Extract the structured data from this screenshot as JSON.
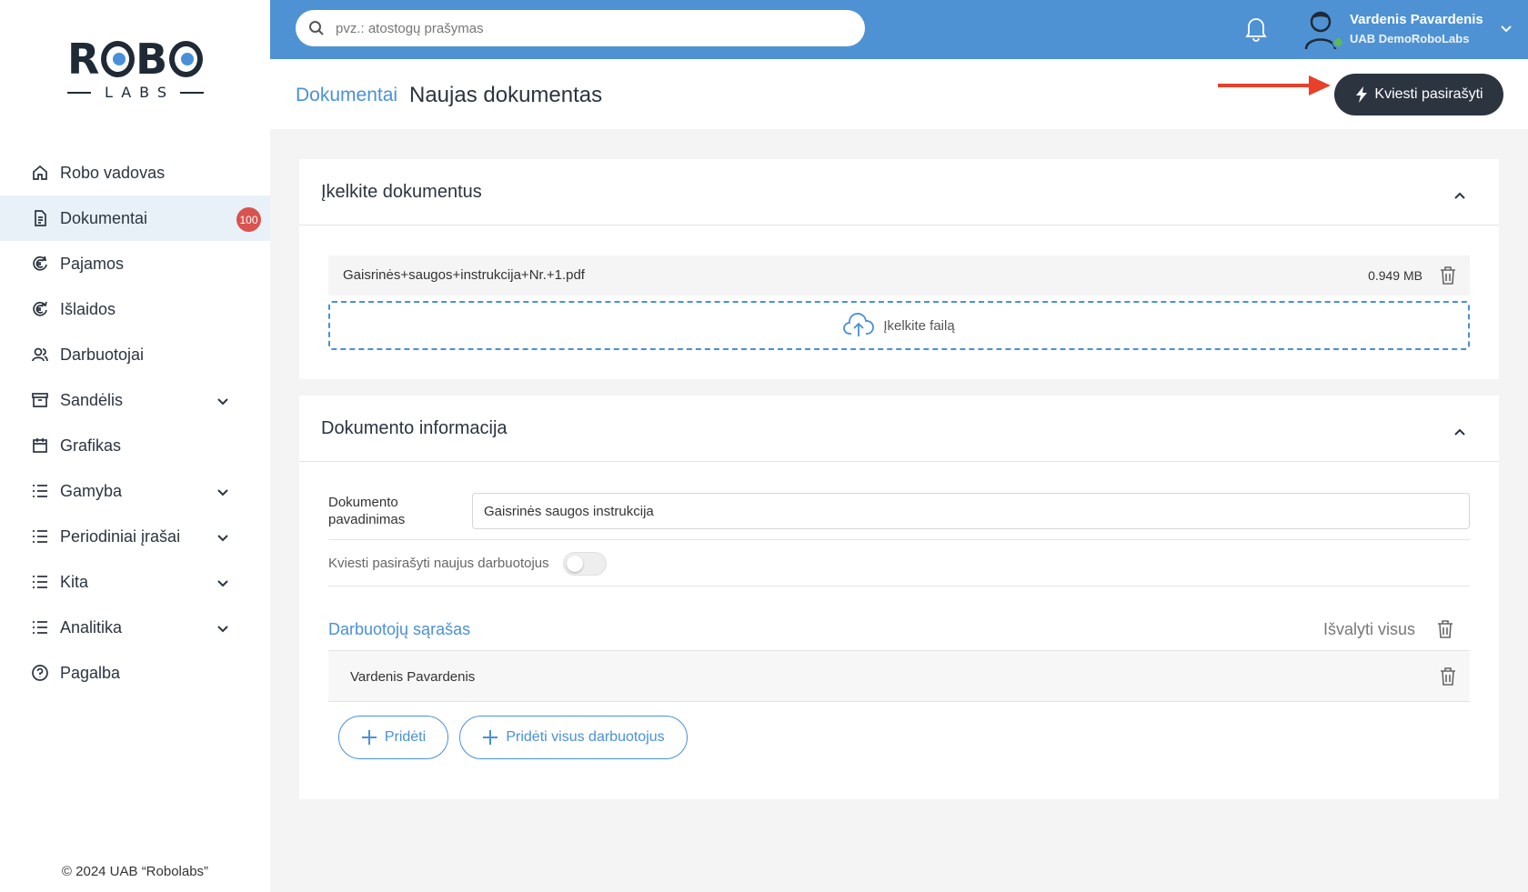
{
  "logo": {
    "word": "ROBO",
    "sub": "LABS"
  },
  "sidebar": {
    "items": [
      {
        "label": "Robo vadovas",
        "icon": "home-icon",
        "expandable": false
      },
      {
        "label": "Dokumentai",
        "icon": "document-icon",
        "expandable": false,
        "active": true,
        "badge": "100"
      },
      {
        "label": "Pajamos",
        "icon": "euro-income-icon",
        "expandable": false
      },
      {
        "label": "Išlaidos",
        "icon": "euro-expense-icon",
        "expandable": false
      },
      {
        "label": "Darbuotojai",
        "icon": "users-icon",
        "expandable": false
      },
      {
        "label": "Sandėlis",
        "icon": "archive-icon",
        "expandable": true
      },
      {
        "label": "Grafikas",
        "icon": "calendar-icon",
        "expandable": false
      },
      {
        "label": "Gamyba",
        "icon": "list-icon",
        "expandable": true
      },
      {
        "label": "Periodiniai įrašai",
        "icon": "list-icon",
        "expandable": true
      },
      {
        "label": "Kita",
        "icon": "list-icon",
        "expandable": true
      },
      {
        "label": "Analitika",
        "icon": "list-icon",
        "expandable": true
      },
      {
        "label": "Pagalba",
        "icon": "help-icon",
        "expandable": false
      }
    ],
    "copyright": "© 2024 UAB “Robolabs”"
  },
  "topbar": {
    "search_placeholder": "pvz.: atostogų prašymas",
    "user_name": "Vardenis Pavardenis",
    "user_company": "UAB DemoRoboLabs"
  },
  "header": {
    "breadcrumb": "Dokumentai",
    "title": "Naujas dokumentas",
    "invite_button": "Kviesti pasirašyti"
  },
  "upload": {
    "title": "Įkelkite dokumentus",
    "file_name": "Gaisrinės+saugos+instrukcija+Nr.+1.pdf",
    "file_size": "0.949 MB",
    "dropzone_label": "Įkelkite failą"
  },
  "info": {
    "title": "Dokumento informacija",
    "name_label": "Dokumento pavadinimas",
    "name_value": "Gaisrinės saugos instrukcija",
    "toggle_label": "Kviesti pasirašyti naujus darbuotojus",
    "toggle_on": false,
    "list_title": "Darbuotojų sąrašas",
    "clear_all": "Išvalyti visus",
    "employees": [
      {
        "name": "Vardenis Pavardenis"
      }
    ],
    "add_button": "Pridėti",
    "add_all_button": "Pridėti visus darbuotojus"
  },
  "colors": {
    "topbar": "#4f92d3",
    "accent": "#4a90d9",
    "dark_button": "#2c3440",
    "badge": "#d9534f",
    "arrow": "#e8402a",
    "online": "#5cb85c"
  }
}
